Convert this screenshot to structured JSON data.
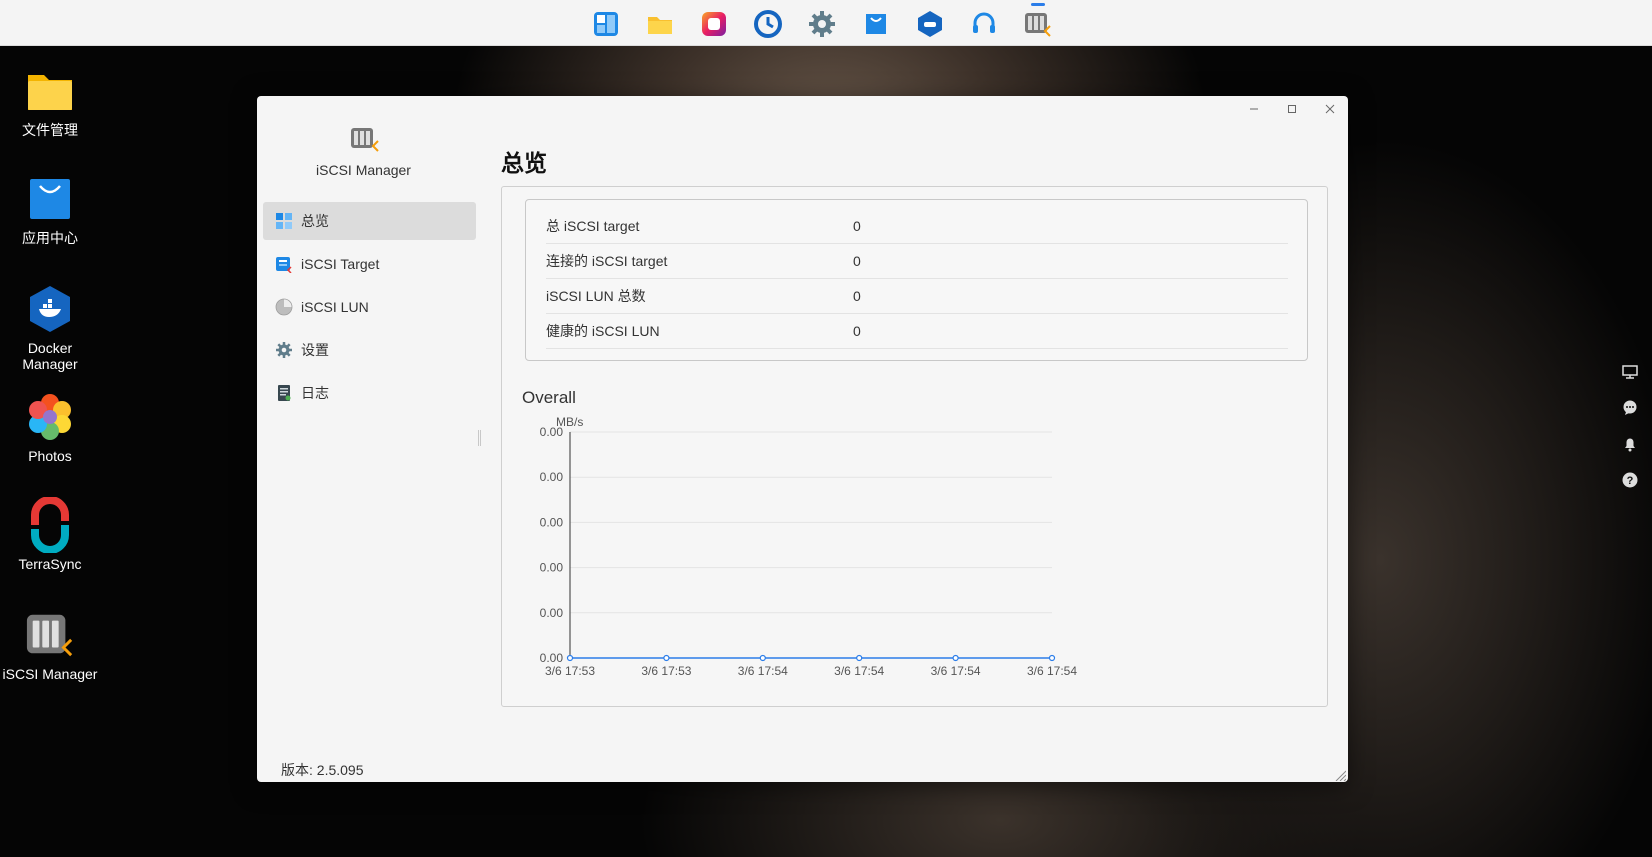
{
  "dock": {
    "items": [
      {
        "name": "tile-launcher",
        "label": ""
      },
      {
        "name": "file-manager",
        "label": ""
      },
      {
        "name": "photos-app",
        "label": ""
      },
      {
        "name": "backup-clock",
        "label": ""
      },
      {
        "name": "settings",
        "label": ""
      },
      {
        "name": "app-center",
        "label": ""
      },
      {
        "name": "docker",
        "label": ""
      },
      {
        "name": "support-headset",
        "label": ""
      },
      {
        "name": "iscsi-manager",
        "label": "",
        "active": true
      }
    ]
  },
  "desktop": {
    "icons": [
      {
        "label": "文件管理",
        "icon": "folder-icon"
      },
      {
        "label": "应用中心",
        "icon": "shopping-bag-icon"
      },
      {
        "label": "Docker\nManager",
        "icon": "docker-icon"
      },
      {
        "label": "Photos",
        "icon": "flower-icon"
      },
      {
        "label": "TerraSync",
        "icon": "sync-icon"
      },
      {
        "label": "iSCSI Manager",
        "icon": "iscsi-icon"
      }
    ],
    "docker_line1": "Docker",
    "docker_line2": "Manager"
  },
  "window": {
    "app_name": "iSCSI Manager",
    "nav": [
      {
        "label": "总览",
        "icon": "overview-grid-icon",
        "selected": true
      },
      {
        "label": "iSCSI Target",
        "icon": "target-icon"
      },
      {
        "label": "iSCSI LUN",
        "icon": "lun-disk-icon"
      },
      {
        "label": "设置",
        "icon": "gear-icon"
      },
      {
        "label": "日志",
        "icon": "log-icon"
      }
    ],
    "version": "版本: 2.5.095",
    "page_title": "总览",
    "stats": [
      {
        "label": "总 iSCSI target",
        "value": "0"
      },
      {
        "label": "连接的 iSCSI target",
        "value": "0"
      },
      {
        "label": "iSCSI LUN 总数",
        "value": "0"
      },
      {
        "label": "健康的 iSCSI LUN",
        "value": "0"
      }
    ],
    "chart_heading": "Overall"
  },
  "chart_data": {
    "type": "line",
    "title": "Overall",
    "ylabel": "MB/s",
    "xlabel": "",
    "categories": [
      "3/6 17:53",
      "3/6 17:53",
      "3/6 17:54",
      "3/6 17:54",
      "3/6 17:54",
      "3/6 17:54"
    ],
    "yticks": [
      "0.00",
      "0.00",
      "0.00",
      "0.00",
      "0.00",
      "0.00"
    ],
    "series": [
      {
        "values": [
          0,
          0,
          0,
          0,
          0,
          0
        ],
        "color": "#2b7de9"
      }
    ],
    "grid": true
  },
  "colors": {
    "accent": "#2b7de9",
    "selected_nav": "#dcdcdc"
  }
}
